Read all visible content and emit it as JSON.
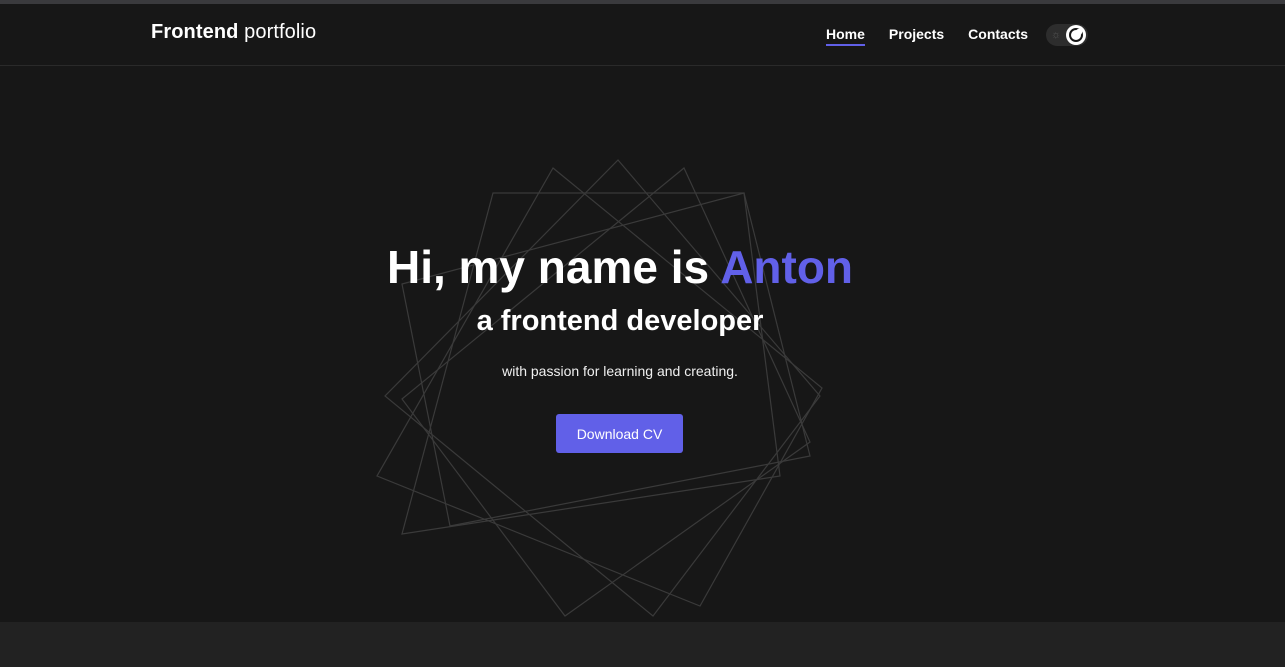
{
  "header": {
    "logo_bold": "Frontend",
    "logo_light": "portfolio",
    "nav": [
      {
        "label": "Home",
        "active": true
      },
      {
        "label": "Projects",
        "active": false
      },
      {
        "label": "Contacts",
        "active": false
      }
    ],
    "theme_toggle": {
      "state": "dark",
      "off_icon": "sun-icon",
      "on_icon": "moon-icon"
    }
  },
  "hero": {
    "greeting": "Hi, my name is",
    "name": "Anton",
    "subtitle": "a frontend developer",
    "description": "with passion for learning and creating.",
    "button_label": "Download CV"
  },
  "colors": {
    "accent": "#6160e8",
    "background": "#171717",
    "footer": "#222222"
  }
}
